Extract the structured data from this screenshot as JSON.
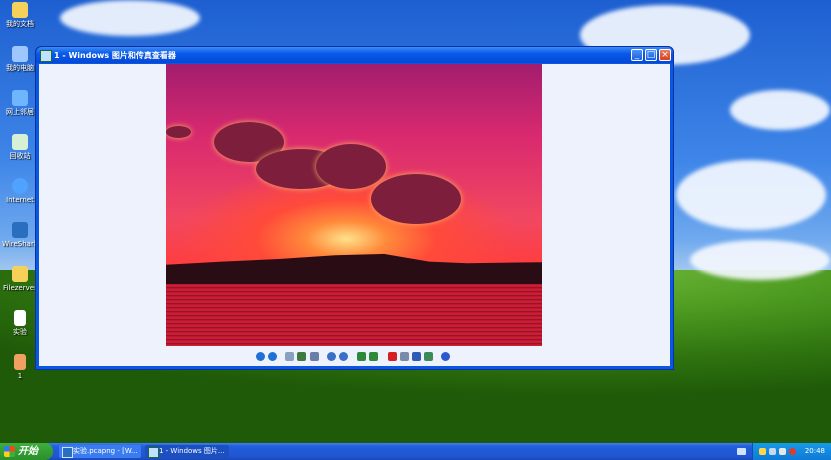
{
  "desktop": {
    "icons": [
      {
        "label": "我的文档",
        "icon": "folder-icon",
        "color": "#f5d15a"
      },
      {
        "label": "我的电脑",
        "icon": "computer-icon",
        "color": "#9fc7ff"
      },
      {
        "label": "网上邻居",
        "icon": "network-icon",
        "color": "#6fb6ff"
      },
      {
        "label": "回收站",
        "icon": "recycle-bin-icon",
        "color": "#d6f0d6"
      },
      {
        "label": "Internet",
        "icon": "internet-explorer-icon",
        "color": "#4fa3ff"
      },
      {
        "label": "WireShark",
        "icon": "wireshark-icon",
        "color": "#2a6fbf"
      },
      {
        "label": "Filezerver",
        "icon": "folder-icon",
        "color": "#f5d15a"
      },
      {
        "label": "实验",
        "icon": "document-icon",
        "color": "#ffffff"
      },
      {
        "label": "1",
        "icon": "image-file-icon",
        "color": "#f0a060"
      }
    ]
  },
  "window": {
    "title": "1 - Windows 图片和传真查看器",
    "buttons": {
      "minimize": "_",
      "maximize": "□",
      "close": "×"
    },
    "toolbar": [
      {
        "name": "previous-image-icon",
        "color": "#1e6fd8"
      },
      {
        "name": "next-image-icon",
        "color": "#1e6fd8"
      },
      {
        "name": "best-fit-icon",
        "color": "#8aa0c0"
      },
      {
        "name": "actual-size-icon",
        "color": "#3d7a3d"
      },
      {
        "name": "slideshow-icon",
        "color": "#6a7ea8"
      },
      {
        "name": "zoom-in-icon",
        "color": "#3a6fc8"
      },
      {
        "name": "zoom-out-icon",
        "color": "#3a6fc8"
      },
      {
        "name": "rotate-clockwise-icon",
        "color": "#2e8a3a"
      },
      {
        "name": "rotate-counterclockwise-icon",
        "color": "#2e8a3a"
      },
      {
        "name": "delete-icon",
        "color": "#d42020"
      },
      {
        "name": "print-icon",
        "color": "#7a8aa8"
      },
      {
        "name": "save-icon",
        "color": "#2e5ab8"
      },
      {
        "name": "open-editor-icon",
        "color": "#3a8a5a"
      },
      {
        "name": "help-icon",
        "color": "#2a5ad0"
      }
    ]
  },
  "taskbar": {
    "start_label": "开始",
    "tasks": [
      {
        "label": "实验.pcapng - [W...",
        "icon": "wireshark-icon"
      },
      {
        "label": "1 - Windows 图片...",
        "icon": "picture-viewer-icon"
      }
    ],
    "tray_icons": [
      "show-desktop-icon",
      "shield-icon",
      "network-icon",
      "volume-icon",
      "security-alert-icon"
    ],
    "clock": "20:48"
  }
}
